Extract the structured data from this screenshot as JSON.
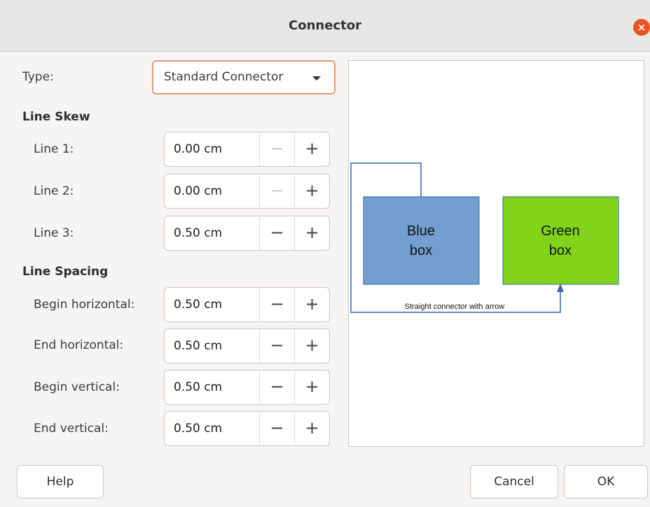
{
  "dialog": {
    "title": "Connector",
    "close_glyph": "×"
  },
  "type": {
    "label": "Type:",
    "value": "Standard Connector"
  },
  "line_skew": {
    "heading": "Line Skew",
    "rows": [
      {
        "label": "Line 1:",
        "value": "0.00 cm"
      },
      {
        "label": "Line 2:",
        "value": "0.00 cm"
      },
      {
        "label": "Line 3:",
        "value": "0.50 cm"
      }
    ]
  },
  "line_spacing": {
    "heading": "Line Spacing",
    "rows": [
      {
        "label": "Begin horizontal:",
        "value": "0.50 cm"
      },
      {
        "label": "End horizontal:",
        "value": "0.50 cm"
      },
      {
        "label": "Begin vertical:",
        "value": "0.50 cm"
      },
      {
        "label": "End vertical:",
        "value": "0.50 cm"
      }
    ]
  },
  "spin": {
    "minus": "−",
    "plus": "+"
  },
  "preview": {
    "blue_box": {
      "line1": "Blue",
      "line2": "box",
      "fill": "#729fcf"
    },
    "green_box": {
      "line1": "Green",
      "line2": "box",
      "fill": "#81d41a"
    },
    "connector_label": "Straight connector with arrow",
    "connector_color": "#3465a4"
  },
  "buttons": {
    "help": "Help",
    "cancel": "Cancel",
    "ok": "OK"
  }
}
